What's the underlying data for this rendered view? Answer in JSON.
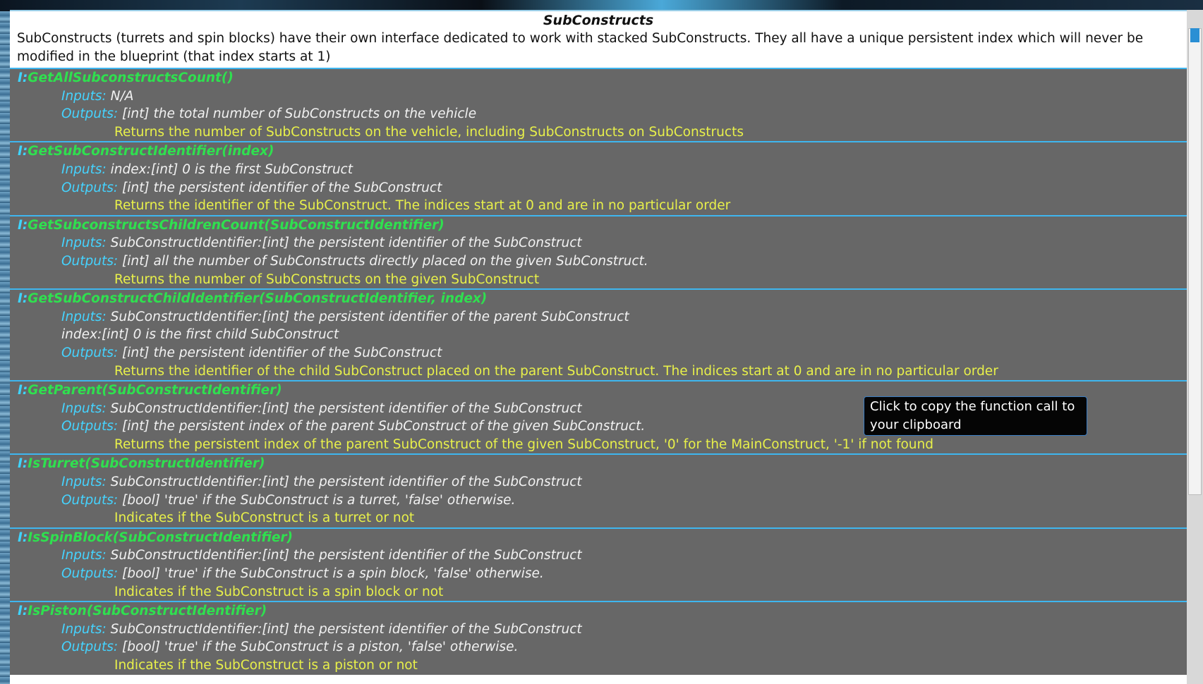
{
  "window": {
    "title": "SubConstructs",
    "intro": "SubConstructs (turrets and spin blocks) have their own interface dedicated to work with stacked SubConstructs. They all have a unique persistent index which will never be modified in the blueprint (that index starts at 1)"
  },
  "labels": {
    "inputs": "Inputs:",
    "outputs": "Outputs:",
    "prefix": "I:"
  },
  "entries": [
    {
      "name": "GetAllSubconstructsCount()",
      "inputs": [
        "N/A"
      ],
      "outputs": "[int] the total number of SubConstructs on the vehicle",
      "description": "Returns the number of SubConstructs on the vehicle, including SubConstructs on SubConstructs"
    },
    {
      "name": "GetSubConstructIdentifier(index)",
      "inputs": [
        "index:[int] 0 is the first SubConstruct"
      ],
      "outputs": "[int] the persistent identifier of the SubConstruct",
      "description": "Returns the identifier of the SubConstruct. The indices start at 0 and are in no particular order"
    },
    {
      "name": "GetSubconstructsChildrenCount(SubConstructIdentifier)",
      "inputs": [
        "SubConstructIdentifier:[int] the persistent identifier of the SubConstruct"
      ],
      "outputs": "[int] all the number of SubConstructs directly placed on the given SubConstruct.",
      "description": "Returns the number of SubConstructs on the given SubConstruct"
    },
    {
      "name": "GetSubConstructChildIdentifier(SubConstructIdentifier, index)",
      "inputs": [
        "SubConstructIdentifier:[int] the persistent identifier of the parent SubConstruct",
        "index:[int] 0 is the first child SubConstruct"
      ],
      "outputs": "[int] the persistent identifier of the SubConstruct",
      "description": "Returns the identifier of the child SubConstruct placed on the parent SubConstruct. The indices start at 0 and are in no particular order"
    },
    {
      "name": "GetParent(SubConstructIdentifier)",
      "inputs": [
        "SubConstructIdentifier:[int] the persistent identifier of the SubConstruct"
      ],
      "outputs": "[int] the persistent index of the parent SubConstruct of the given SubConstruct.",
      "description": "Returns the persistent index of the parent SubConstruct of the given SubConstruct, '0' for the MainConstruct, '-1' if not found"
    },
    {
      "name": "IsTurret(SubConstructIdentifier)",
      "inputs": [
        "SubConstructIdentifier:[int] the persistent identifier of the SubConstruct"
      ],
      "outputs": "[bool] 'true' if the SubConstruct is a turret, 'false' otherwise.",
      "description": "Indicates if the SubConstruct is a turret or not"
    },
    {
      "name": "IsSpinBlock(SubConstructIdentifier)",
      "inputs": [
        "SubConstructIdentifier:[int] the persistent identifier of the SubConstruct"
      ],
      "outputs": "[bool] 'true' if the SubConstruct is a spin block, 'false' otherwise.",
      "description": "Indicates if the SubConstruct is a spin block or not"
    },
    {
      "name": "IsPiston(SubConstructIdentifier)",
      "inputs": [
        "SubConstructIdentifier:[int] the persistent identifier of the SubConstruct"
      ],
      "outputs": "[bool] 'true' if the SubConstruct is a piston, 'false' otherwise.",
      "description": "Indicates if the SubConstruct is a piston or not"
    }
  ],
  "tooltip": {
    "text": "Click to copy the function call to your clipboard"
  },
  "colors": {
    "entry_bg": "#676767",
    "function_name": "#2fe04f",
    "label": "#45d3ff",
    "description": "#e8f04a",
    "separator": "#3eb6ef"
  }
}
